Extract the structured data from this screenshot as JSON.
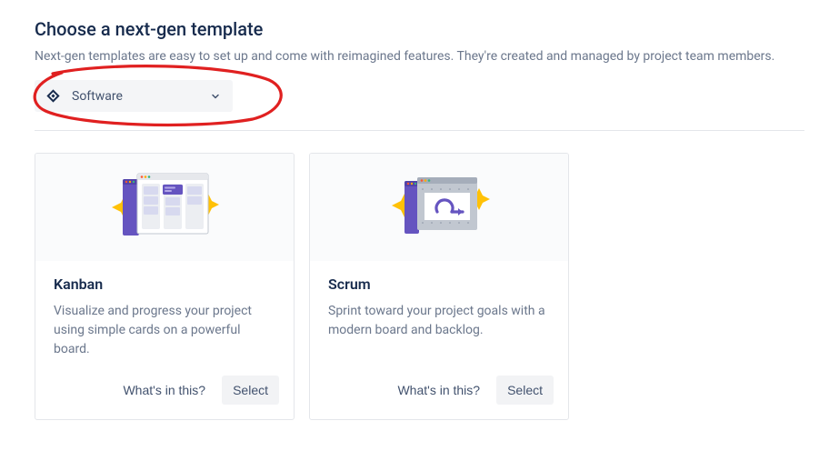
{
  "heading": "Choose a next-gen template",
  "subheading": "Next-gen templates are easy to set up and come with reimagined features. They're created and managed by project team members.",
  "category_dropdown": {
    "selected": "Software"
  },
  "templates": [
    {
      "title": "Kanban",
      "description": "Visualize and progress your project using simple cards on a powerful board.",
      "whats_in_label": "What's in this?",
      "select_label": "Select"
    },
    {
      "title": "Scrum",
      "description": "Sprint toward your project goals with a modern board and backlog.",
      "whats_in_label": "What's in this?",
      "select_label": "Select"
    }
  ]
}
